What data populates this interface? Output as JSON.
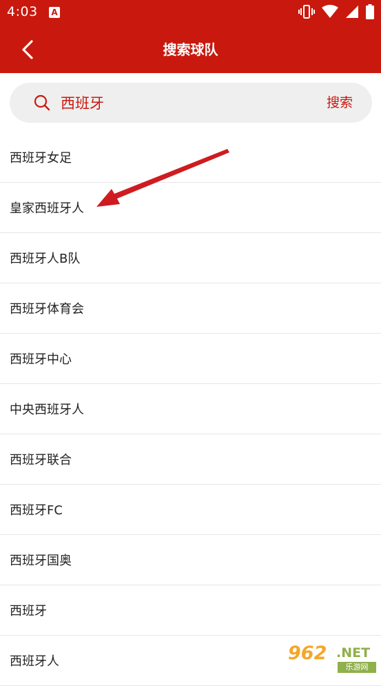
{
  "status_bar": {
    "time": "4:03",
    "notification_icon": "A"
  },
  "header": {
    "title": "搜索球队",
    "back_icon": "chevron-left-icon"
  },
  "search": {
    "value": "西班牙",
    "placeholder": "",
    "button_label": "搜索",
    "icon": "search-icon"
  },
  "results": [
    "西班牙女足",
    "皇家西班牙人",
    "西班牙人B队",
    "西班牙体育会",
    "西班牙中心",
    "中央西班牙人",
    "西班牙联合",
    "西班牙FC",
    "西班牙国奥",
    "西班牙",
    "西班牙人"
  ],
  "watermark": {
    "number": "962",
    "suffix": ".NET",
    "cn": "乐游网"
  },
  "colors": {
    "brand_red": "#c9190e",
    "search_bg": "#efefef",
    "text": "#222222",
    "divider": "#e6e6e6",
    "annotation_arrow": "#d9151b"
  }
}
